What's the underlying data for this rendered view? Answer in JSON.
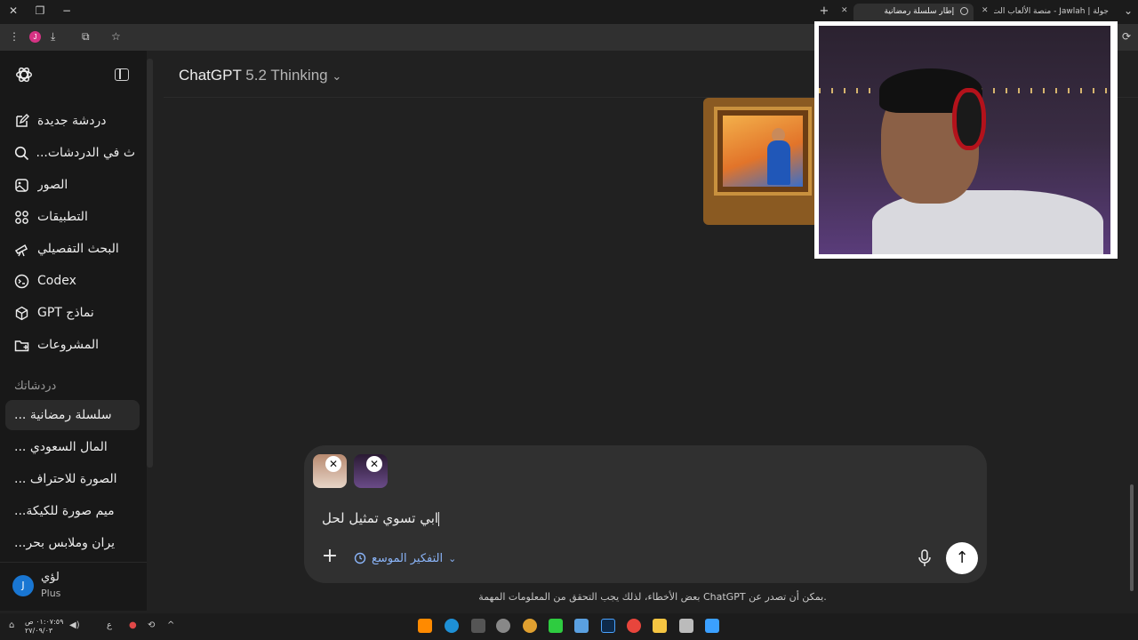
{
  "browser": {
    "tabs": [
      {
        "title": "إطار سلسلة رمضانية",
        "active": true
      },
      {
        "title": "جولة | Jawlah - منصة الألعاب الت",
        "active": false
      }
    ],
    "new_tab": "+",
    "window_controls": {
      "close": "✕",
      "restore": "❐",
      "minimize": "−"
    },
    "profile_initial": "J"
  },
  "sidebar": {
    "items": [
      {
        "label": "دردشة جديدة",
        "icon": "new-chat-icon"
      },
      {
        "label": "ث في الدردشات...",
        "icon": "search-icon"
      },
      {
        "label": "الصور",
        "icon": "images-icon"
      },
      {
        "label": "التطبيقات",
        "icon": "apps-icon"
      },
      {
        "label": "البحث التفصيلي",
        "icon": "telescope-icon"
      },
      {
        "label": "Codex",
        "icon": "codex-icon"
      },
      {
        "label": "نماذج GPT",
        "icon": "cube-icon"
      },
      {
        "label": "المشروعات",
        "icon": "folder-plus-icon"
      }
    ],
    "section_title": "دردشاتك",
    "chats": [
      {
        "label": "... سلسلة رمضانية",
        "active": true
      },
      {
        "label": "... المال السعودي",
        "active": false
      },
      {
        "label": "... الصورة للاحتراف",
        "active": false
      },
      {
        "label": "...ميم صورة للكيكة",
        "active": false
      },
      {
        "label": "...يران وملابس بحر",
        "active": false
      }
    ],
    "user": {
      "initial": "J",
      "name": "لؤي",
      "plan": "Plus"
    }
  },
  "main": {
    "model_name": "ChatGPT",
    "model_version": "5.2 Thinking"
  },
  "composer": {
    "text": "ابي تسوي تمثيل لحل",
    "tool_label": "التفكير الموسع",
    "plus": "+",
    "send": "↑",
    "remove": "✕"
  },
  "disclaimer": "بعض الأخطاء، لذلك يجب التحقق من المعلومات المهمة ChatGPT يمكن أن تصدر عن.",
  "taskbar": {
    "time": "٠١:٠٧:٥٩ ص",
    "date": "٢٧/٠٩/٠٣",
    "lang": "ع"
  },
  "colors": {
    "accent_blue": "#8ab4f8",
    "avatar_blue": "#1976d2",
    "profile_pink": "#d63384"
  }
}
